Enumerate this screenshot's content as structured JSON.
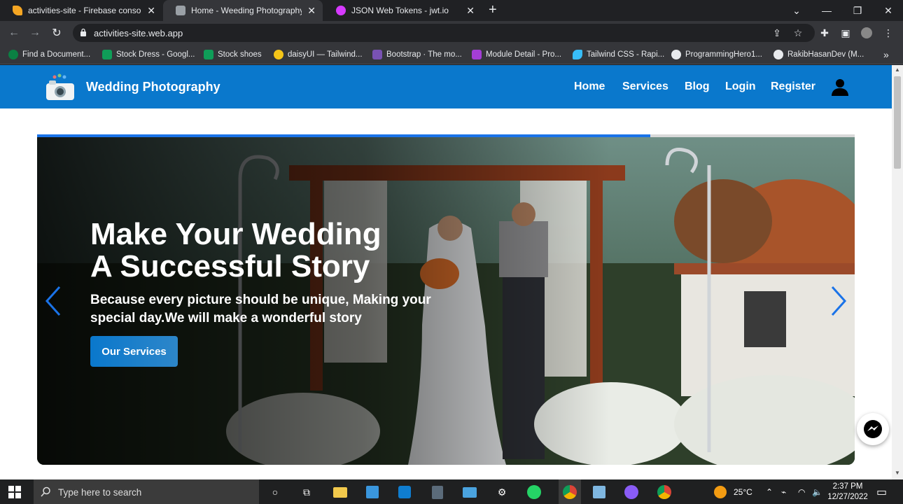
{
  "browser": {
    "tabs": [
      {
        "title": "activities-site - Firebase console",
        "active": false
      },
      {
        "title": "Home - Weeding Photography",
        "active": true
      },
      {
        "title": "JSON Web Tokens - jwt.io",
        "active": false
      }
    ],
    "url": "activities-site.web.app",
    "bookmarks": [
      "Find a Document...",
      "Stock Dress - Googl...",
      "Stock shoes",
      "daisyUI — Tailwind...",
      "Bootstrap · The mo...",
      "Module Detail - Pro...",
      "Tailwind CSS - Rapi...",
      "ProgrammingHero1...",
      "RakibHasanDev (M..."
    ]
  },
  "site": {
    "brand": "Wedding Photography",
    "nav": [
      "Home",
      "Services",
      "Blog",
      "Login",
      "Register"
    ],
    "hero": {
      "headline_line1": "Make Your Wedding",
      "headline_line2": "A Successful Story",
      "subtitle": "Because every picture should be unique, Making your special day.We will make a wonderful story",
      "cta": "Our Services",
      "slide_progress": 0.75
    }
  },
  "taskbar": {
    "search_placeholder": "Type here to search",
    "weather": "25°C",
    "time": "2:37 PM",
    "date": "12/27/2022"
  },
  "colors": {
    "navbar": "#0a78cc",
    "accent": "#1a73e8"
  }
}
